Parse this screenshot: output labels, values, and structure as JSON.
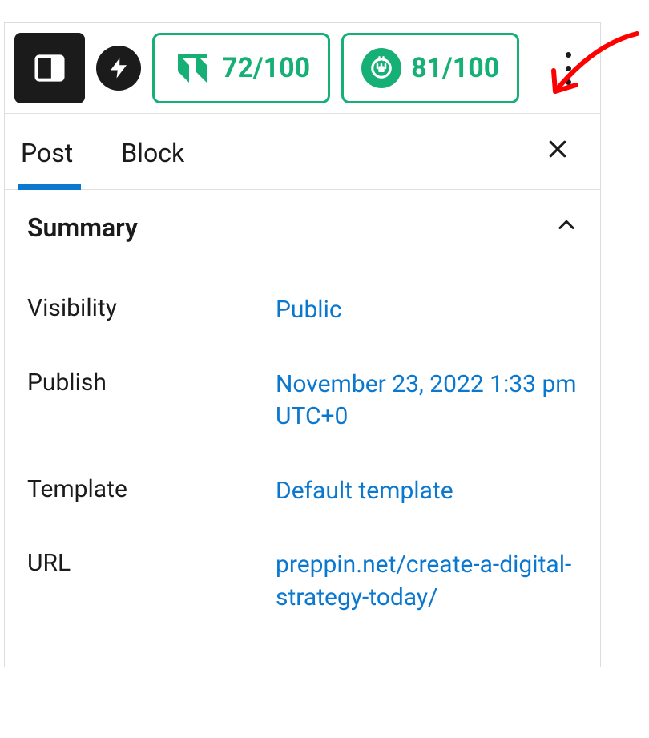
{
  "toolbar": {
    "scores": [
      {
        "value": "72/100"
      },
      {
        "value": "81/100"
      }
    ]
  },
  "tabs": {
    "items": [
      {
        "label": "Post",
        "active": true
      },
      {
        "label": "Block",
        "active": false
      }
    ]
  },
  "summary": {
    "title": "Summary",
    "rows": [
      {
        "label": "Visibility",
        "value": "Public"
      },
      {
        "label": "Publish",
        "value": "November 23, 2022 1:33 pm UTC+0"
      },
      {
        "label": "Template",
        "value": "Default template"
      },
      {
        "label": "URL",
        "value": "preppin.net/create-a-digital-strategy-today/"
      }
    ]
  }
}
